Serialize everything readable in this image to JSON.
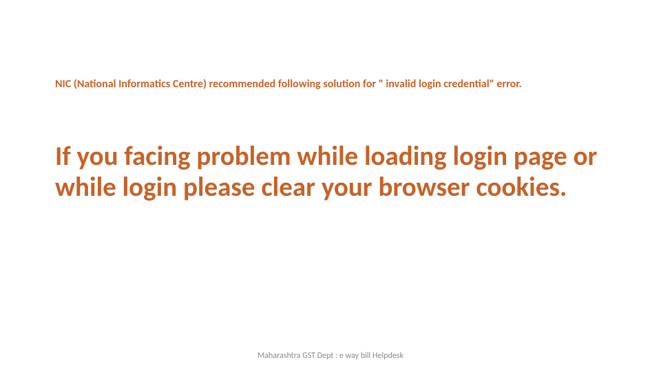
{
  "slide": {
    "subtitle": "NIC (National Informatics Centre)  recommended following solution for \" invalid login credential\" error.",
    "main_heading": "If you facing problem while loading login page or while login please clear your browser cookies.",
    "footer": "Maharashtra GST Dept : e way bill Helpdesk"
  }
}
